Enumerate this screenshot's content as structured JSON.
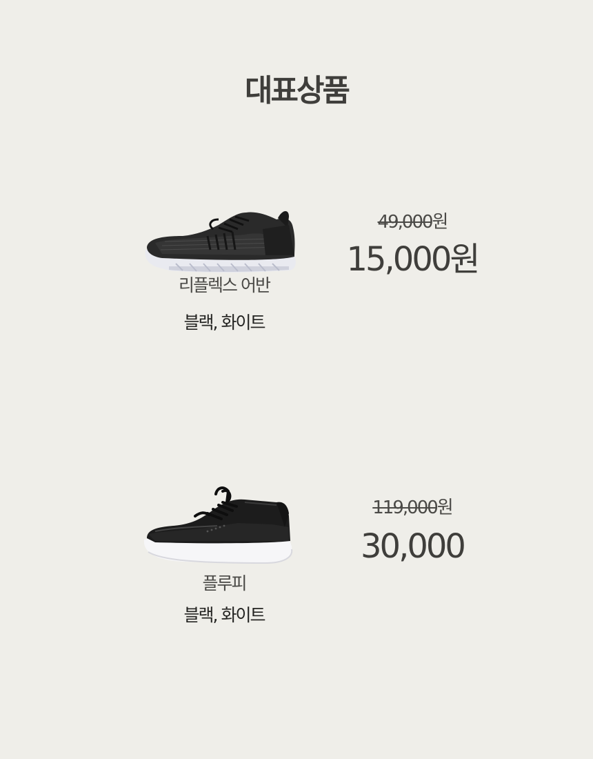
{
  "section": {
    "title": "대표상품"
  },
  "products": [
    {
      "image_icon": "black-knit-sneaker-image",
      "name": "리플렉스 어반",
      "colors": "블랙, 화이트",
      "old_price_number": "49,000",
      "old_price_unit": "원",
      "new_price": "15,000원"
    },
    {
      "image_icon": "black-leather-sneaker-image",
      "name": "플루피",
      "colors": "블랙, 화이트",
      "old_price_number": "119,000",
      "old_price_unit": "원",
      "new_price": "30,000"
    }
  ],
  "colors": {
    "background": "#efeee9",
    "text": "#3f3e3b",
    "shoe_body": "#1c1c1c",
    "shoe_sole": "#f4f4f6"
  }
}
